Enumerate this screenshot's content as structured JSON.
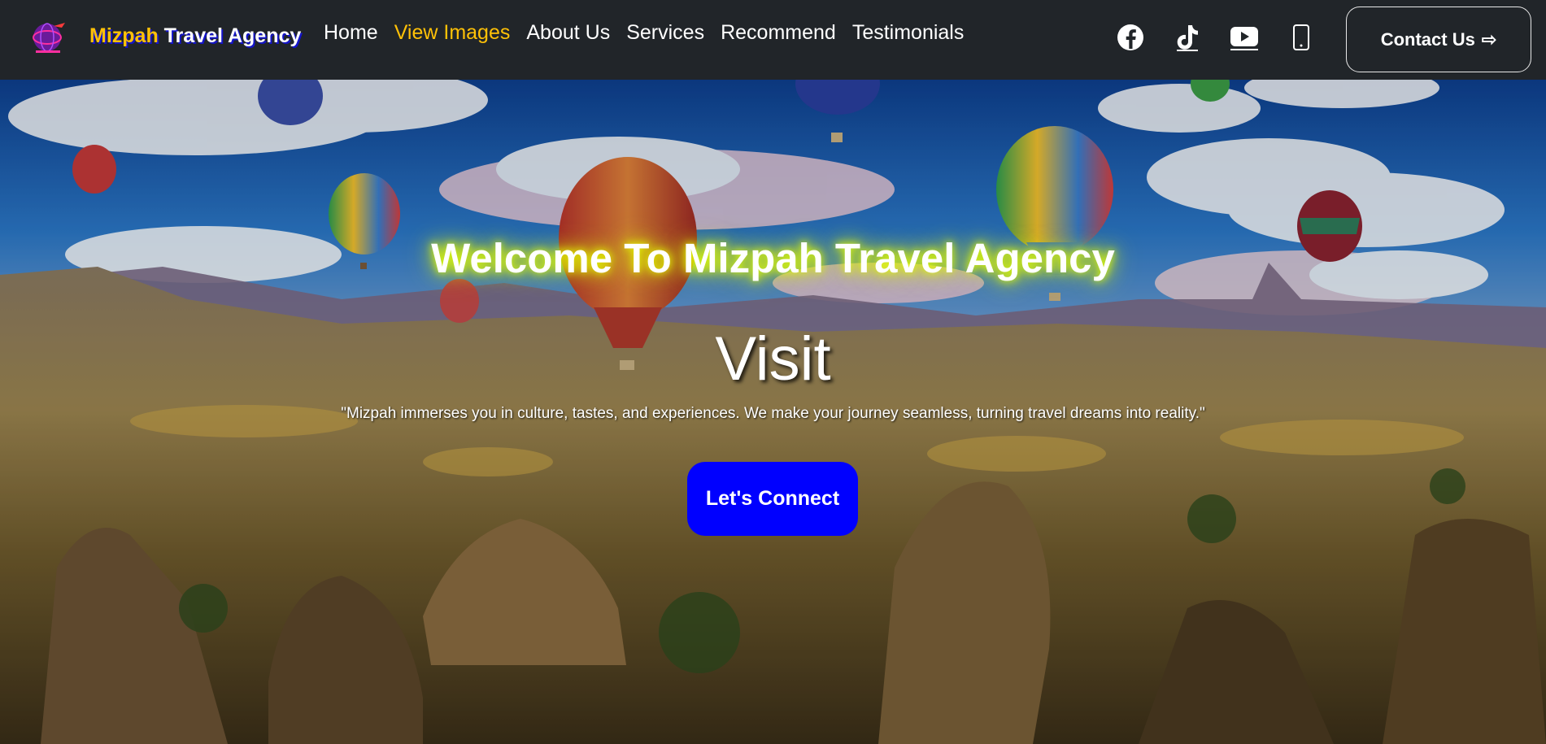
{
  "navbar": {
    "logo_icon": "globe-plane-logo-icon",
    "brand_part1": "Mizpah",
    "brand_part2": " Travel Agency",
    "links": [
      {
        "label": "Home"
      },
      {
        "label": "View Images",
        "active": true
      },
      {
        "label": "About Us"
      },
      {
        "label": "Services"
      },
      {
        "label": "Recommend"
      },
      {
        "label": "Testimonials"
      }
    ],
    "social_icons": [
      "facebook-icon",
      "tiktok-icon",
      "youtube-icon",
      "phone-icon"
    ],
    "contact_label": "Contact Us",
    "contact_arrow": "⇨"
  },
  "hero": {
    "background": "hot-air-balloons-cappadocia-landscape",
    "title": "Welcome To Mizpah Travel Agency",
    "subtitle": "Visit",
    "quote": "\"Mizpah immerses you in culture, tastes, and experiences. We make your journey seamless, turning travel dreams into reality.\"",
    "button_label": "Let's Connect"
  },
  "colors": {
    "navbar_bg": "#212529",
    "accent_yellow": "#ffc107",
    "button_blue": "#0000ff",
    "title_glow": "#e5ff00"
  }
}
